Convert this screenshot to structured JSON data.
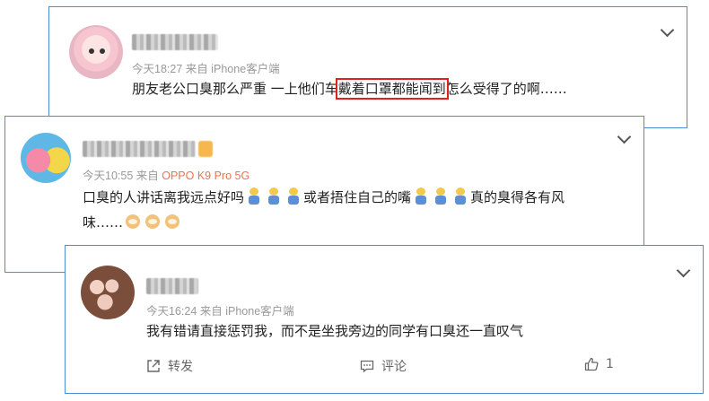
{
  "comments": [
    {
      "meta": "今天18:27  来自 iPhone客户端",
      "text_before": "朋友老公口臭那么严重 一上他们车",
      "text_highlight": "戴着口罩都能闻到",
      "text_after": "怎么受得了的啊……"
    },
    {
      "meta_prefix": "今天10:55  来自 ",
      "meta_source": "OPPO K9 Pro 5G",
      "text_part1": "口臭的人讲话离我远点好吗",
      "text_part2": "或者捂住自己的嘴",
      "text_part3": "真的臭得各有风",
      "text_line2": "味……"
    },
    {
      "meta": "今天16:24  来自 iPhone客户端",
      "text": "我有错请直接惩罚我，而不是坐我旁边的同学有口臭还一直叹气",
      "actions": {
        "repost_label": "转发",
        "comment_label": "评论",
        "like_count": "1"
      }
    }
  ],
  "colors": {
    "border": "#4a90d9",
    "highlight_box": "#e02020",
    "source_orange": "#eb7350",
    "meta_gray": "#999999"
  },
  "icons": [
    "chevron-down-icon",
    "repost-icon",
    "comment-icon",
    "like-icon",
    "avatar"
  ]
}
